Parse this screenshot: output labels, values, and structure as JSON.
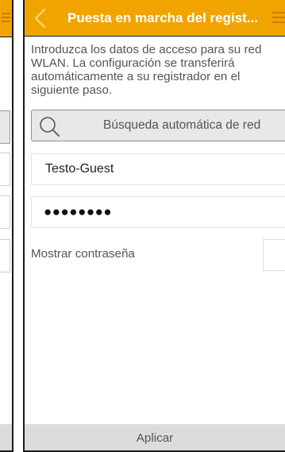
{
  "header": {
    "title": "Puesta en marcha del regist...",
    "accent_color": "#f1a400",
    "back_icon": "chevron-left-icon",
    "menu_icon": "hamburger-menu-icon"
  },
  "instructions": "Introduzca los datos de acceso para su red WLAN. La configuración se transferirá automáticamente a su registrador en el siguiente paso.",
  "search": {
    "label": "Búsqueda automática de red",
    "icon": "search-icon"
  },
  "form": {
    "ssid_value": "Testo-Guest",
    "password_masked": "●●●●●●●●",
    "show_password_label": "Mostrar contraseña",
    "show_password_checked": false
  },
  "footer": {
    "apply_label": "Aplicar"
  }
}
